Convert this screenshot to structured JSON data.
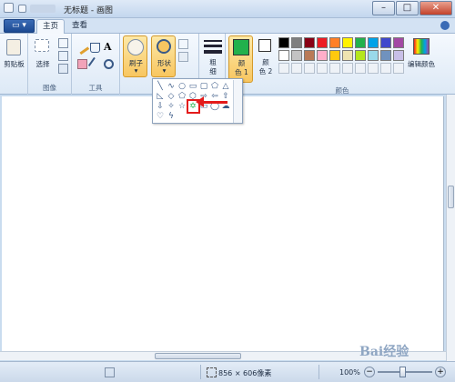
{
  "titlebar": {
    "title": "无标题 - 画图"
  },
  "tabs": [
    {
      "label": "主页"
    },
    {
      "label": "查看"
    }
  ],
  "ribbon": {
    "clipboard": {
      "label": "剪贴板",
      "group": ""
    },
    "image": {
      "select": "选择",
      "group": "图像"
    },
    "tools": {
      "group": "工具",
      "text_tool": "A"
    },
    "brush": {
      "label": "刷子"
    },
    "shapes": {
      "label": "形状"
    },
    "size": {
      "label": "粗",
      "label2": "细"
    },
    "color1": {
      "label": "颜",
      "label2": "色 1"
    },
    "color2": {
      "label": "颜",
      "label2": "色 2"
    },
    "edit_colors": {
      "label": "编辑颜色"
    },
    "colors_group": {
      "label": "颜色"
    }
  },
  "status": {
    "size": "856 × 606像素",
    "zoom": "100%"
  },
  "palette": {
    "row1": [
      "#000000",
      "#7f7f7f",
      "#880015",
      "#ed1c24",
      "#ff7f27",
      "#fff200",
      "#22b14c",
      "#00a2e8",
      "#3f48cc",
      "#a349a4"
    ],
    "row2": [
      "#ffffff",
      "#c3c3c3",
      "#b97a57",
      "#ffaec9",
      "#ffc90e",
      "#efe4b0",
      "#b5e61d",
      "#99d9ea",
      "#7092be",
      "#c8bfe7"
    ]
  },
  "watermark": "Bai经验"
}
